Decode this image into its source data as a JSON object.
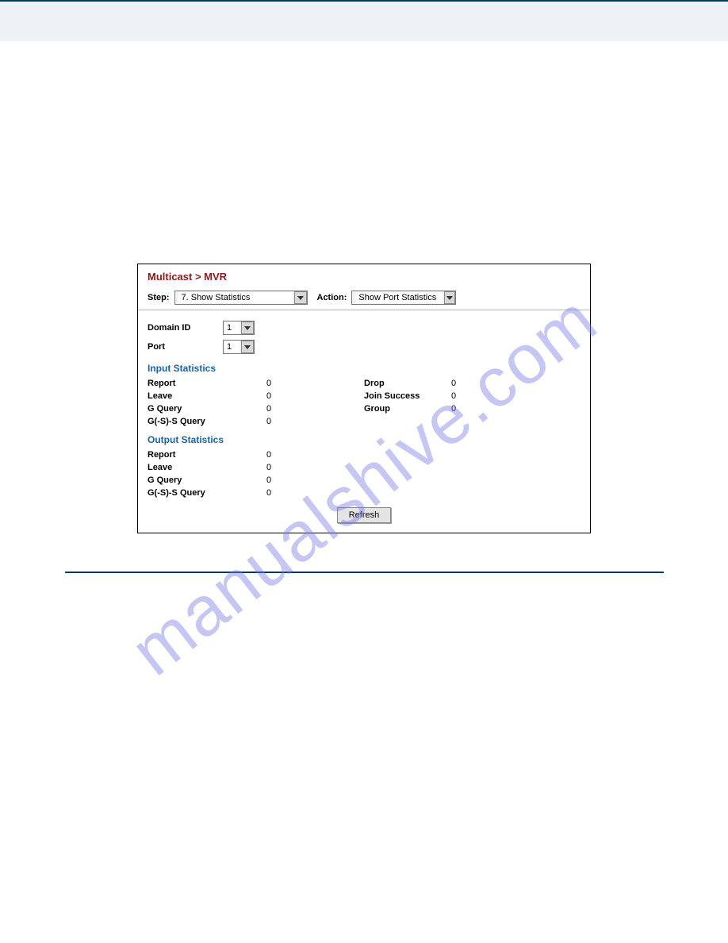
{
  "watermark": "manualshive.com",
  "panel": {
    "breadcrumb": "Multicast > MVR",
    "filters": {
      "step_label": "Step:",
      "step_value": "7. Show Statistics",
      "action_label": "Action:",
      "action_value": "Show Port Statistics"
    },
    "domain": {
      "domain_id_label": "Domain ID",
      "domain_id_value": "1",
      "port_label": "Port",
      "port_value": "1"
    },
    "input_section": {
      "heading": "Input Statistics",
      "left": [
        {
          "label": "Report",
          "value": "0"
        },
        {
          "label": "Leave",
          "value": "0"
        },
        {
          "label": "G Query",
          "value": "0"
        },
        {
          "label": "G(-S)-S Query",
          "value": "0"
        }
      ],
      "right": [
        {
          "label": "Drop",
          "value": "0"
        },
        {
          "label": "Join Success",
          "value": "0"
        },
        {
          "label": "Group",
          "value": "0"
        }
      ]
    },
    "output_section": {
      "heading": "Output Statistics",
      "rows": [
        {
          "label": "Report",
          "value": "0"
        },
        {
          "label": "Leave",
          "value": "0"
        },
        {
          "label": "G Query",
          "value": "0"
        },
        {
          "label": "G(-S)-S Query",
          "value": "0"
        }
      ]
    },
    "refresh_label": "Refresh"
  }
}
